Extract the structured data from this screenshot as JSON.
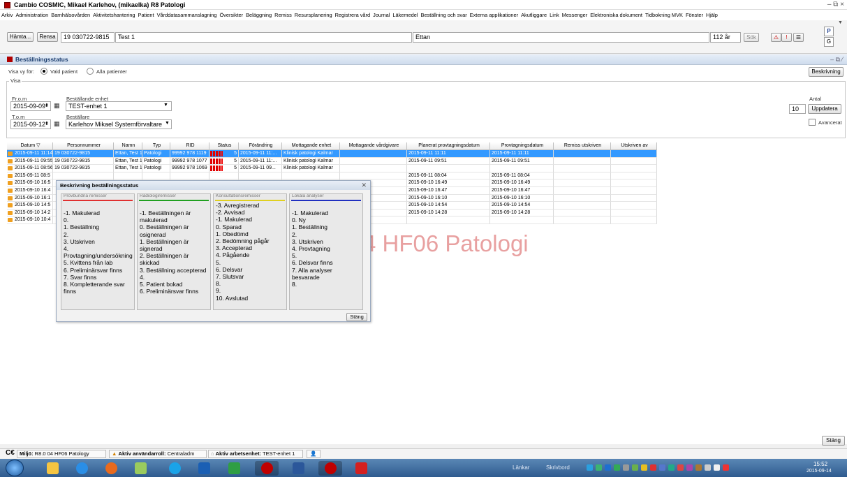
{
  "window": {
    "title": "Cambio COSMIC, Mikael Karlehov, (mikaelka) R8 Patologi",
    "controls": "– ⧉ ×"
  },
  "menu": [
    "Arkiv",
    "Administration",
    "Barnhälsovården",
    "Aktivitetshantering",
    "Patient",
    "Vårddatasammanslagning",
    "Översikter",
    "Beläggning",
    "Remiss",
    "Resursplanering",
    "Registrera vård",
    "Journal",
    "Läkemedel",
    "Beställning och svar",
    "Externa applikationer",
    "Akutliggare",
    "Link",
    "Messenger",
    "Elektroniska dokument",
    "Tidbokning MVK",
    "Fönster",
    "Hjälp"
  ],
  "patient_bar": {
    "fetch_label": "Hämta...",
    "clear_label": "Rensa",
    "pnr": "19 030722-9815",
    "name": "Test 1",
    "unit": "Ettan",
    "age": "112 år",
    "search_label": "Sök",
    "p_label": "P",
    "g_label": "G"
  },
  "panel": {
    "title": "Beställningsstatus",
    "view_for_label": "Visa vy för:",
    "radio_selected": "Vald patient",
    "radio_all": "Alla patienter",
    "describe_label": "Beskrivning",
    "group_label": "Visa",
    "from_label": "Fr.o.m",
    "from_value": "2015-09-09",
    "to_label": "T.o.m",
    "to_value": "2015-09-12",
    "unit_label": "Beställande enhet",
    "unit_value": "TEST-enhet 1",
    "orderer_label": "Beställare",
    "orderer_value": "Karlehov Mikael Systemförvaltare",
    "count_label": "Antal",
    "count_value": "10",
    "update_label": "Uppdatera",
    "advanced_label": "Avancerat",
    "close_label": "Stäng"
  },
  "table": {
    "columns": [
      "Datum ▽",
      "Personnummer",
      "Namn",
      "Typ",
      "RID",
      "Status",
      "Förändring",
      "Mottagande enhet",
      "Mottagande vårdgivare",
      "Planerat provtagningsdatum",
      "Provtagningsdatum",
      "Remiss utskriven",
      "Utskriven av"
    ],
    "rows": [
      {
        "datum": "2015-09-11 11:14",
        "pnr": "19 030722-9815",
        "namn": "Ettan, Test 1",
        "typ": "Patologi",
        "rid": "99992 978 1119",
        "status": "5",
        "forandring": "2015-09-11 11:...",
        "enhet": "Klinisk patologi Kalmar",
        "vardgivare": "",
        "planerat": "2015-09-11 11:11",
        "prov": "2015-09-11 11:11",
        "utskriven": "",
        "av": ""
      },
      {
        "datum": "2015-09-11 09:55",
        "pnr": "19 030722-9815",
        "namn": "Ettan, Test 1",
        "typ": "Patologi",
        "rid": "99992 978 1077",
        "status": "5",
        "forandring": "2015-09-11 11:...",
        "enhet": "Klinisk patologi Kalmar",
        "vardgivare": "",
        "planerat": "2015-09-11 09:51",
        "prov": "2015-09-11 09:51",
        "utskriven": "",
        "av": ""
      },
      {
        "datum": "2015-09-11 08:56",
        "pnr": "19 030722-9815",
        "namn": "Ettan, Test 1",
        "typ": "Patologi",
        "rid": "99992 978 1069",
        "status": "5",
        "forandring": "2015-09-11 09...",
        "enhet": "Klinisk patologi Kalmar",
        "vardgivare": "",
        "planerat": "",
        "prov": "",
        "utskriven": "",
        "av": ""
      },
      {
        "datum": "2015-09-11 08:5",
        "pnr": "",
        "namn": "",
        "typ": "",
        "rid": "",
        "status": "",
        "forandring": "",
        "enhet": "",
        "vardgivare": "",
        "planerat": "2015-09-11 08:04",
        "prov": "2015-09-11 08:04",
        "utskriven": "",
        "av": ""
      },
      {
        "datum": "2015-09-10 16:5",
        "pnr": "",
        "namn": "",
        "typ": "",
        "rid": "",
        "status": "",
        "forandring": "",
        "enhet": "",
        "vardgivare": "",
        "planerat": "2015-09-10 16:49",
        "prov": "2015-09-10 16:49",
        "utskriven": "",
        "av": ""
      },
      {
        "datum": "2015-09-10 16:4",
        "pnr": "",
        "namn": "",
        "typ": "",
        "rid": "",
        "status": "",
        "forandring": "",
        "enhet": "",
        "vardgivare": "",
        "planerat": "2015-09-10 16:47",
        "prov": "2015-09-10 16:47",
        "utskriven": "",
        "av": ""
      },
      {
        "datum": "2015-09-10 16:1",
        "pnr": "",
        "namn": "",
        "typ": "",
        "rid": "",
        "status": "",
        "forandring": "",
        "enhet": "",
        "vardgivare": "",
        "planerat": "2015-09-10 16:10",
        "prov": "2015-09-10 16:10",
        "utskriven": "",
        "av": ""
      },
      {
        "datum": "2015-09-10 14:5",
        "pnr": "",
        "namn": "",
        "typ": "",
        "rid": "",
        "status": "",
        "forandring": "",
        "enhet": "",
        "vardgivare": "",
        "planerat": "2015-09-10 14:54",
        "prov": "2015-09-10 14:54",
        "utskriven": "",
        "av": ""
      },
      {
        "datum": "2015-09-10 14:2",
        "pnr": "",
        "namn": "",
        "typ": "",
        "rid": "",
        "status": "",
        "forandring": "",
        "enhet": "",
        "vardgivare": "",
        "planerat": "2015-09-10 14:28",
        "prov": "2015-09-10 14:28",
        "utskriven": "",
        "av": ""
      },
      {
        "datum": "2015-09-10 10:4",
        "pnr": "",
        "namn": "",
        "typ": "",
        "rid": "",
        "status": "",
        "forandring": "",
        "enhet": "",
        "vardgivare": "",
        "planerat": "",
        "prov": "",
        "utskriven": "",
        "av": ""
      }
    ]
  },
  "watermark": "4 HF06 Patologi",
  "dialog": {
    "title": "Beskrivning beställningsstatus",
    "close_label": "Stäng",
    "columns": [
      {
        "title": "Provbundna remisser",
        "color": "#e03030",
        "items": [
          "-1. Makulerad",
          "0.",
          "1. Beställning",
          "2.",
          "3. Utskriven",
          "4. Provtagning/undersökning",
          "5. Kvittens från lab",
          "6. Preliminärsvar finns",
          "7. Svar finns",
          "8. Kompletterande svar finns"
        ]
      },
      {
        "title": "Radiologiremisser",
        "color": "#20a020",
        "items": [
          "-1. Beställningen är makulerad",
          "0. Beställningen är osignerad",
          "1. Beställningen är signerad",
          "2. Beställningen är skickad",
          "3. Beställning accepterad",
          "4.",
          "5. Patient bokad",
          "6. Preliminärsvar finns"
        ]
      },
      {
        "title": "Konsultationsremisser",
        "color": "#e0d020",
        "items": [
          "-3. Avregistrerad",
          "-2. Avvisad",
          "-1. Makulerad",
          "0. Sparad",
          "1. Obedömd",
          "2. Bedömning pågår",
          "3. Accepterad",
          "4. Pågående",
          "5.",
          "6. Delsvar",
          "7. Slutsvar",
          "8.",
          "9.",
          "10. Avslutad"
        ]
      },
      {
        "title": "Lokala analyser",
        "color": "#2030c0",
        "items": [
          "-1. Makulerad",
          "0. Ny",
          "1. Beställning",
          "2.",
          "3. Utskriven",
          "4. Provtagning",
          "5.",
          "6. Delsvar finns",
          "7. Alla analyser besvarade",
          "8."
        ]
      }
    ]
  },
  "statusbar": {
    "env_label": "Miljö:",
    "env_value": "R8.0 04 HF06 Patology",
    "role_label": "Aktiv användarroll:",
    "role_value": "Centraladm",
    "unit_label": "Aktiv arbetsenhet:",
    "unit_value": "TEST-enhet 1"
  },
  "taskbar": {
    "links_label": "Länkar",
    "desktop_label": "Skrivbord",
    "time": "15:52",
    "date": "2015-09-14"
  }
}
